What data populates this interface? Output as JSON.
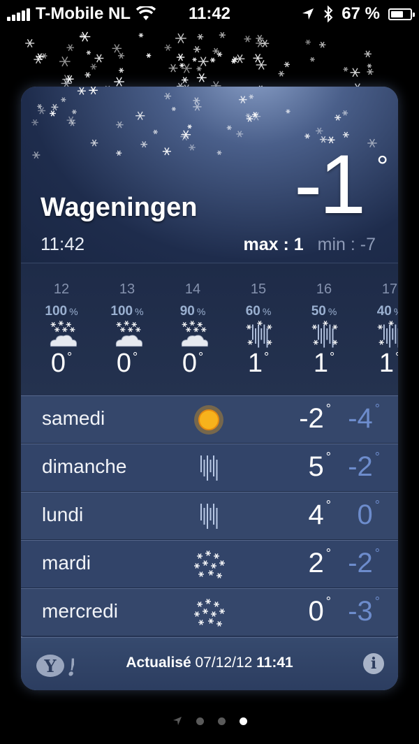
{
  "status": {
    "carrier": "T-Mobile NL",
    "time": "11:42",
    "battery_text": "67 %",
    "battery_level": 0.67
  },
  "weather": {
    "city": "Wageningen",
    "local_time": "11:42",
    "current_temp": "-1",
    "degree_symbol": "°",
    "max_label": "max : 1",
    "min_label": "min : -7"
  },
  "hourly": [
    {
      "hour": "12",
      "pct": "100",
      "temp": "0",
      "icon": "snow-cloud-icon"
    },
    {
      "hour": "13",
      "pct": "100",
      "temp": "0",
      "icon": "snow-cloud-icon"
    },
    {
      "hour": "14",
      "pct": "90",
      "temp": "0",
      "icon": "snow-cloud-icon"
    },
    {
      "hour": "15",
      "pct": "60",
      "temp": "1",
      "icon": "sleet-icon"
    },
    {
      "hour": "16",
      "pct": "50",
      "temp": "1",
      "icon": "sleet-icon"
    },
    {
      "hour": "17",
      "pct": "40",
      "temp": "1",
      "icon": "sleet-icon"
    }
  ],
  "percent_sign": "%",
  "daily": [
    {
      "day": "samedi",
      "high": "-2",
      "low": "-4",
      "icon": "sun-icon"
    },
    {
      "day": "dimanche",
      "high": "5",
      "low": "-2",
      "icon": "rain-icon"
    },
    {
      "day": "lundi",
      "high": "4",
      "low": "0",
      "icon": "rain-icon"
    },
    {
      "day": "mardi",
      "high": "2",
      "low": "-2",
      "icon": "snow-icon"
    },
    {
      "day": "mercredi",
      "high": "0",
      "low": "-3",
      "icon": "snow-icon"
    }
  ],
  "footer": {
    "updated_label": "Actualisé",
    "updated_date": "07/12/12",
    "updated_time": "11:41",
    "info_label": "i",
    "provider_icon": "yahoo-logo-icon"
  },
  "pager": {
    "pages": 3,
    "active": 3
  }
}
